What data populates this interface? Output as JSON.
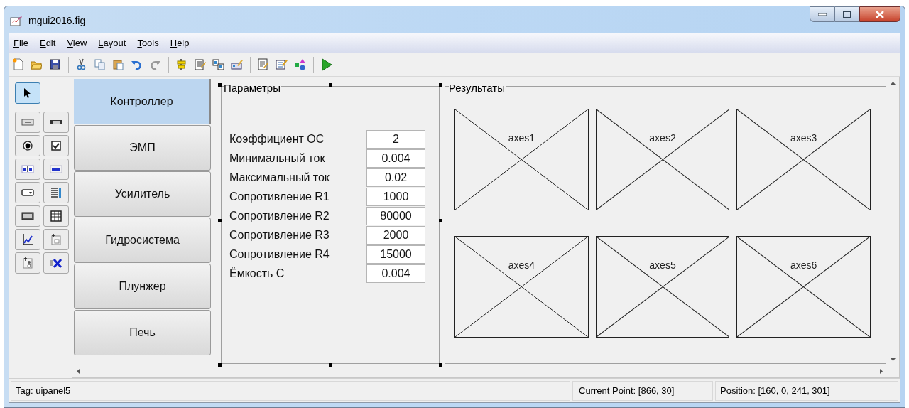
{
  "window": {
    "title": "mgui2016.fig"
  },
  "menu": [
    "File",
    "Edit",
    "View",
    "Layout",
    "Tools",
    "Help"
  ],
  "palette": [
    {
      "kind": "select",
      "selected": true
    },
    {
      "kind": "pushbutton",
      "selected": false
    },
    {
      "kind": "slider",
      "selected": false
    },
    {
      "kind": "radio",
      "selected": false
    },
    {
      "kind": "checkbox",
      "selected": false
    },
    {
      "kind": "edit",
      "selected": false
    },
    {
      "kind": "text",
      "selected": false
    },
    {
      "kind": "popup",
      "selected": false
    },
    {
      "kind": "listbox",
      "selected": false
    },
    {
      "kind": "toggle",
      "selected": false
    },
    {
      "kind": "table",
      "selected": false
    },
    {
      "kind": "axes",
      "selected": false
    },
    {
      "kind": "panel",
      "selected": false
    },
    {
      "kind": "buttongroup",
      "selected": false
    },
    {
      "kind": "activex",
      "selected": false
    }
  ],
  "tabs": [
    {
      "label": "Контроллер",
      "selected": true
    },
    {
      "label": "ЭМП",
      "selected": false
    },
    {
      "label": "Усилитель",
      "selected": false
    },
    {
      "label": "Гидросистема",
      "selected": false
    },
    {
      "label": "Плунжер",
      "selected": false
    },
    {
      "label": "Печь",
      "selected": false
    }
  ],
  "parameters": {
    "title": "Параметры",
    "selected": true,
    "rows": [
      {
        "label": "Коэффициент ОС",
        "value": "2"
      },
      {
        "label": "Минимальный ток",
        "value": "0.004"
      },
      {
        "label": "Максимальный ток",
        "value": "0.02"
      },
      {
        "label": "Сопротивление R1",
        "value": "1000"
      },
      {
        "label": "Сопротивление R2",
        "value": "80000"
      },
      {
        "label": "Сопротивление R3",
        "value": "2000"
      },
      {
        "label": "Сопротивление R4",
        "value": "15000"
      },
      {
        "label": "Ёмкость С",
        "value": "0.004"
      }
    ]
  },
  "results": {
    "title": "Результаты",
    "axes": [
      "axes1",
      "axes2",
      "axes3",
      "axes4",
      "axes5",
      "axes6"
    ]
  },
  "status_bar": {
    "tag": "Tag: uipanel5",
    "current_point": "Current Point:  [866, 30]",
    "position": "Position: [160, 0, 241, 301]"
  }
}
